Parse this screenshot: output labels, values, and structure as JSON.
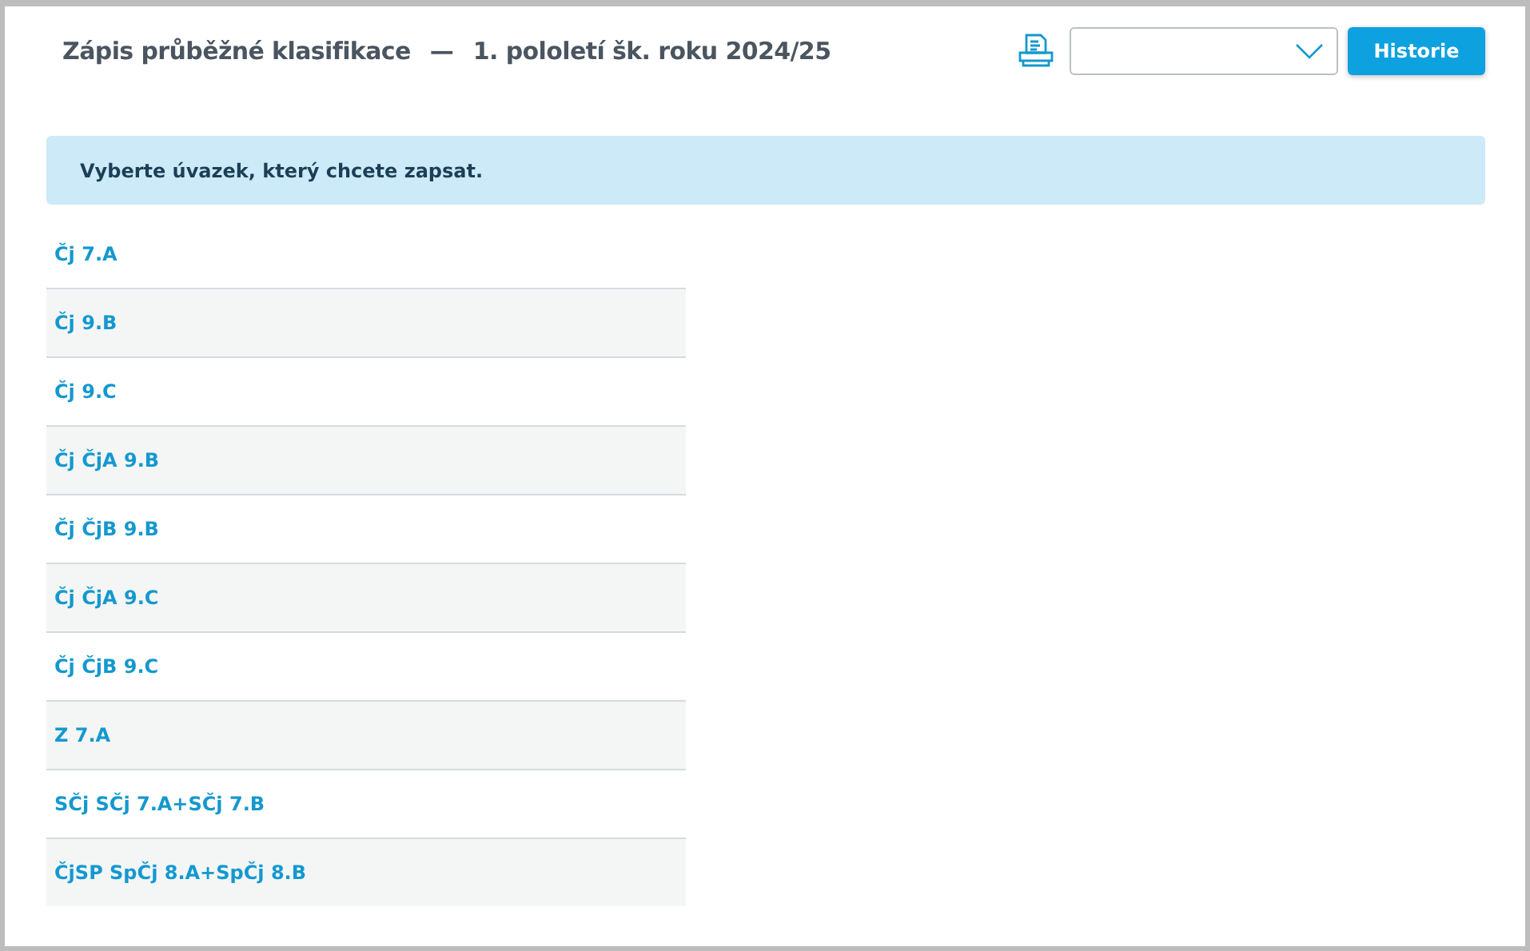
{
  "header": {
    "title": "Zápis průběžné klasifikace",
    "separator": "—",
    "period": "1. pololetí šk. roku 2024/25"
  },
  "toolbar": {
    "history_button": "Historie"
  },
  "notice": "Vyberte úvazek, který chcete zapsat.",
  "assignments": [
    {
      "label": "Čj 7.A"
    },
    {
      "label": "Čj 9.B"
    },
    {
      "label": "Čj 9.C"
    },
    {
      "label": "Čj ČjA 9.B"
    },
    {
      "label": "Čj ČjB 9.B"
    },
    {
      "label": "Čj ČjA 9.C"
    },
    {
      "label": "Čj ČjB 9.C"
    },
    {
      "label": "Z 7.A"
    },
    {
      "label": "SČj SČj 7.A+SČj 7.B"
    },
    {
      "label": "ČjSP SpČj 8.A+SpČj 8.B"
    }
  ]
}
